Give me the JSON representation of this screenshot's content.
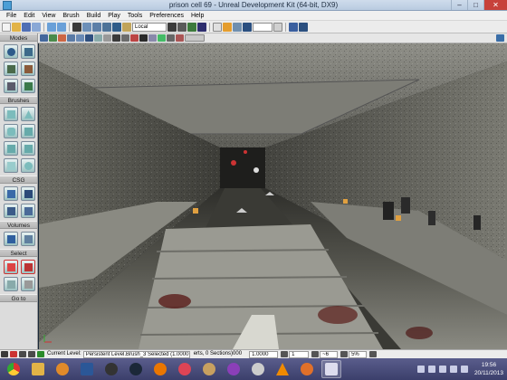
{
  "window": {
    "title": "prison cell 69 - Unreal Development Kit (64-bit, DX9)",
    "controls": {
      "minimize": "–",
      "maximize": "□",
      "close": "✕"
    }
  },
  "menu": [
    "File",
    "Edit",
    "View",
    "Brush",
    "Build",
    "Play",
    "Tools",
    "Preferences",
    "Help"
  ],
  "toolbar": {
    "grid_select": "Local"
  },
  "left_panel": {
    "sections": [
      "Modes",
      "Brushes",
      "CSG",
      "Volumes",
      "Select",
      "Go to"
    ]
  },
  "status_bar": {
    "current_level_label": "Current Level:",
    "current_level_value": "Persistent Level.Brush_3 Selected (1.0000",
    "selection_text": "erts, 0 Sections)000",
    "drag_value": "1.0000",
    "grid_value": "1",
    "rotation_value": "~6",
    "scale_value": "5%"
  },
  "taskbar": {
    "apps": [
      "chrome",
      "file-explorer",
      "media-player",
      "word",
      "steam",
      "app",
      "app",
      "app",
      "app",
      "app",
      "app",
      "app",
      "app",
      "udk"
    ],
    "time": "19:56",
    "date": "20/11/2013"
  },
  "colors": {
    "titlebar": "#c5d6ea",
    "taskbar": "#4a4d7c",
    "accent_orange": "#e0a040"
  }
}
